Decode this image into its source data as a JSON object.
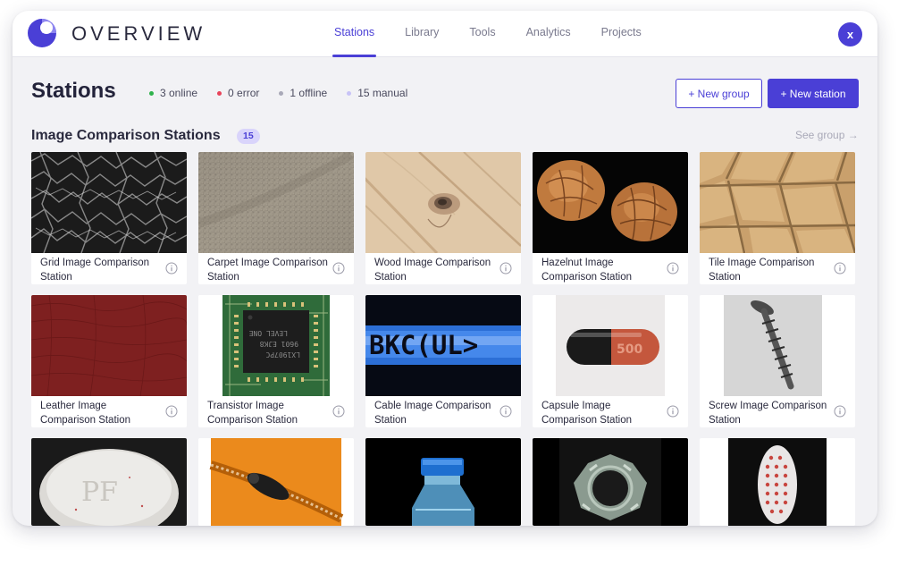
{
  "brand": {
    "name": "OVERVIEW",
    "logo_icon": "overview-logo-icon",
    "accent": "#4a3fd6"
  },
  "nav": {
    "items": [
      {
        "label": "Stations",
        "active": true
      },
      {
        "label": "Library",
        "active": false
      },
      {
        "label": "Tools",
        "active": false
      },
      {
        "label": "Analytics",
        "active": false
      },
      {
        "label": "Projects",
        "active": false
      }
    ]
  },
  "user": {
    "initial": "x"
  },
  "header": {
    "title": "Stations",
    "status": [
      {
        "label": "3 online",
        "color": "#2fb24b"
      },
      {
        "label": "0 error",
        "color": "#e8435a"
      },
      {
        "label": "1 offline",
        "color": "#a9a9b8"
      },
      {
        "label": "15 manual",
        "color": "#c8c3f7"
      }
    ],
    "new_group_label": "+ New group",
    "new_station_label": "+ New station"
  },
  "section": {
    "title": "Image Comparison Stations",
    "count": "15",
    "see_group_label": "See group →"
  },
  "stations": [
    {
      "label": "Grid Image Comparison Station",
      "image": "grid-texture"
    },
    {
      "label": "Carpet Image Comparison Station",
      "image": "carpet-texture"
    },
    {
      "label": "Wood Image Comparison Station",
      "image": "wood-texture"
    },
    {
      "label": "Hazelnut Image Comparison Station",
      "image": "hazelnuts"
    },
    {
      "label": "Tile Image Comparison Station",
      "image": "tile-texture"
    },
    {
      "label": "Leather Image Comparison Station",
      "image": "leather-texture"
    },
    {
      "label": "Transistor Image Comparison Station",
      "image": "circuit-board"
    },
    {
      "label": "Cable Image Comparison Station",
      "image": "cable-print",
      "print_text": "BKC(UL>"
    },
    {
      "label": "Capsule Image Comparison Station",
      "image": "capsule",
      "print_text": "500"
    },
    {
      "label": "Screw Image Comparison Station",
      "image": "screw"
    },
    {
      "label": "",
      "image": "pill"
    },
    {
      "label": "",
      "image": "zipper"
    },
    {
      "label": "",
      "image": "bottle"
    },
    {
      "label": "",
      "image": "metal-nut"
    },
    {
      "label": "",
      "image": "toothbrush"
    }
  ]
}
